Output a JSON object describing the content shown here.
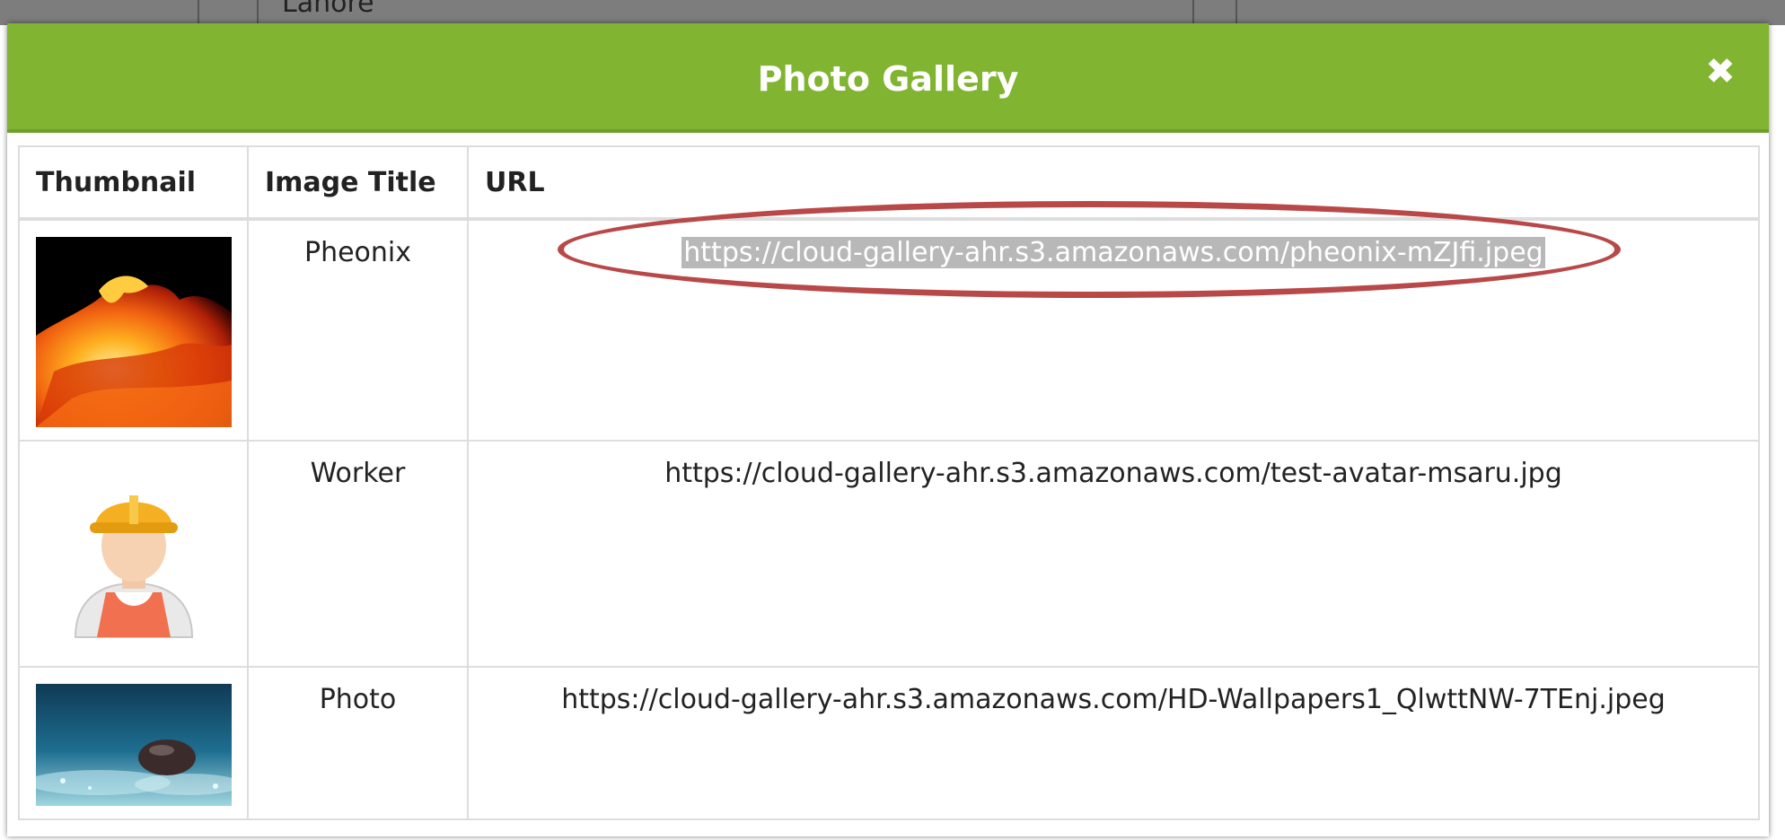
{
  "background": {
    "partial_text": "Lahore"
  },
  "modal": {
    "title": "Photo Gallery",
    "close_icon": "close-icon",
    "header_color": "#80b431"
  },
  "table": {
    "headers": {
      "thumbnail": "Thumbnail",
      "title": "Image Title",
      "url": "URL"
    },
    "rows": [
      {
        "thumbnail_icon": "phoenix-fire-image",
        "title": "Pheonix",
        "url": "https://cloud-gallery-ahr.s3.amazonaws.com/pheonix-mZJfi.jpeg",
        "selected": true
      },
      {
        "thumbnail_icon": "worker-avatar-image",
        "title": "Worker",
        "url": "https://cloud-gallery-ahr.s3.amazonaws.com/test-avatar-msaru.jpg",
        "selected": false
      },
      {
        "thumbnail_icon": "water-drop-wallpaper-image",
        "title": "Photo",
        "url": "https://cloud-gallery-ahr.s3.amazonaws.com/HD-Wallpapers1_QlwttNW-7TEnj.jpeg",
        "selected": false
      }
    ]
  },
  "annotation": {
    "color": "#b94848",
    "shape": "ellipse"
  }
}
